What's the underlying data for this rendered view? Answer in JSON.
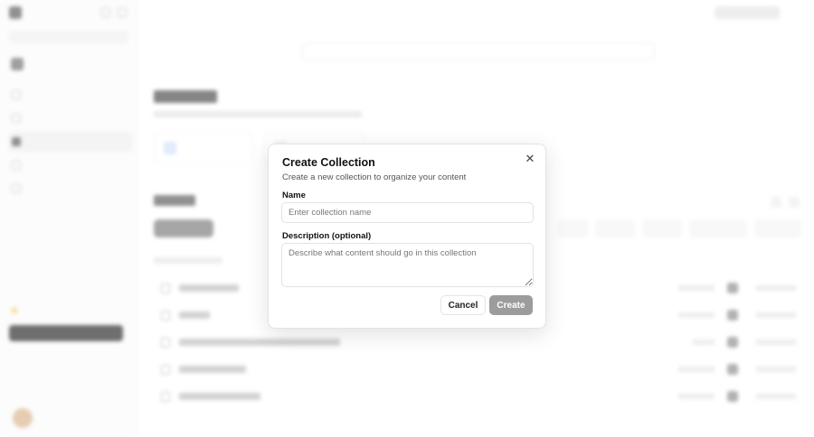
{
  "modal": {
    "title": "Create Collection",
    "subtitle": "Create a new collection to organize your content",
    "close_icon": "close-icon",
    "name_label": "Name",
    "name_placeholder": "Enter collection name",
    "name_value": "",
    "description_label": "Description (optional)",
    "description_placeholder": "Describe what content should go in this collection",
    "description_value": "",
    "cancel_label": "Cancel",
    "create_label": "Create",
    "create_enabled": false
  },
  "colors": {
    "create_button_disabled": "#9c9c9c",
    "overlay": "#ffffff",
    "accent_star": "#f1c24b"
  }
}
